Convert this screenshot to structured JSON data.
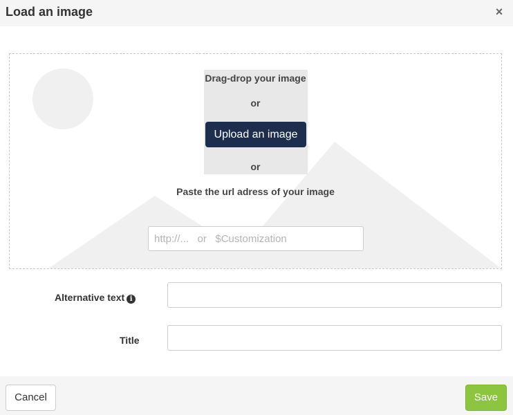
{
  "dialog": {
    "title": "Load an image",
    "close_icon": "close-icon",
    "close_glyph": "×"
  },
  "dropzone": {
    "drag_text": "Drag-drop your image",
    "or_1": "or",
    "upload_label": "Upload an image",
    "or_2": "or",
    "paste_text": "Paste the url adress of your image",
    "url_placeholder": "http://...   or   $Customization",
    "url_value": ""
  },
  "form": {
    "alt_label": "Alternative text",
    "alt_info_icon": "info-icon",
    "alt_info_glyph": "i",
    "alt_value": "",
    "title_label": "Title",
    "title_value": ""
  },
  "footer": {
    "cancel_label": "Cancel",
    "save_label": "Save"
  },
  "colors": {
    "upload_button": "#1d2d4d",
    "save_button": "#8cc63f",
    "header_bg": "#f5f5f5"
  }
}
